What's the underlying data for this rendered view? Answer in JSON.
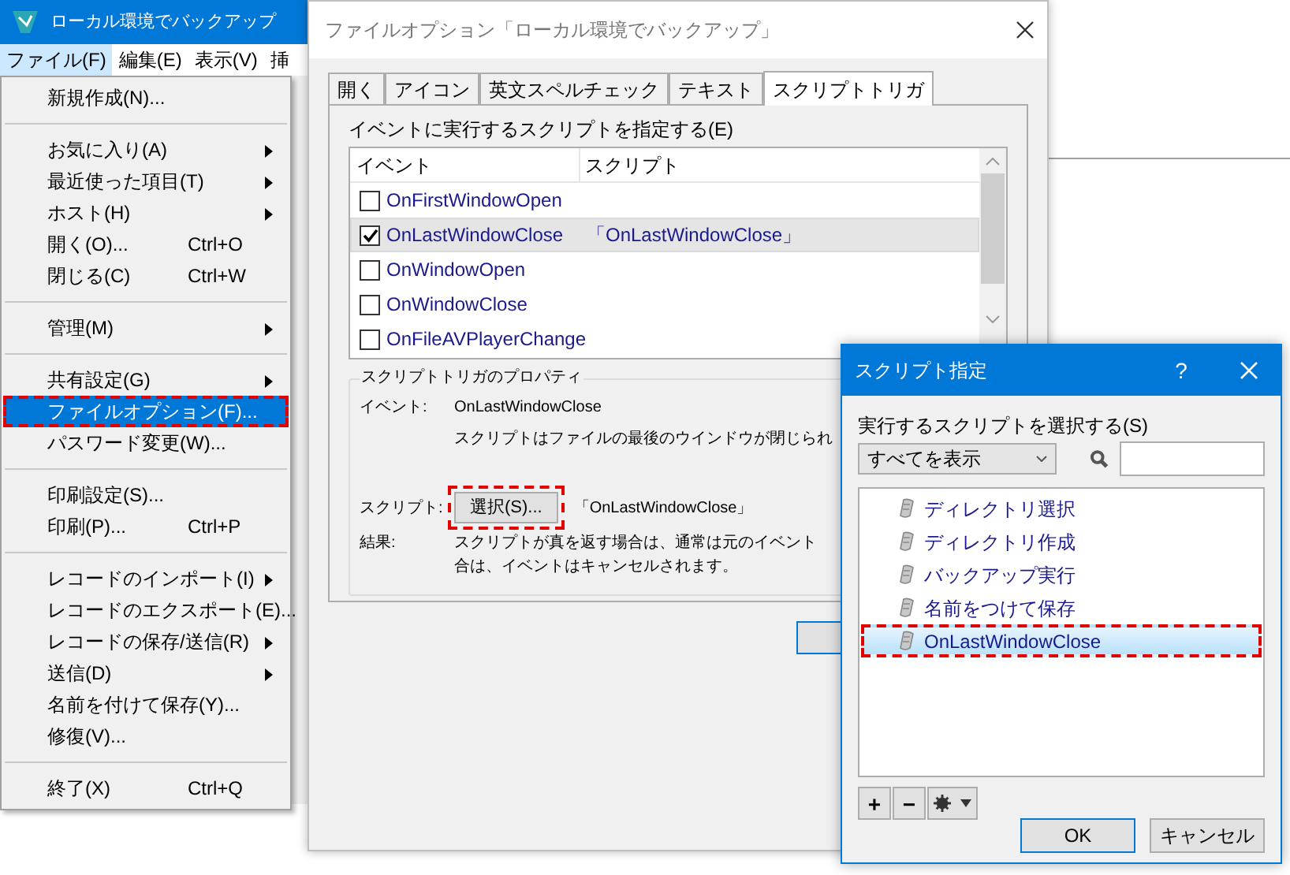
{
  "app_window": {
    "title": "ローカル環境でバックアップ",
    "menu_bar": [
      {
        "label": "ファイル(F)",
        "selected": true
      },
      {
        "label": "編集(E)",
        "selected": false
      },
      {
        "label": "表示(V)",
        "selected": false
      },
      {
        "label": "挿",
        "selected": false
      }
    ]
  },
  "file_menu": [
    {
      "kind": "item",
      "label": "新規作成(N)...",
      "submenu": false,
      "selected": false,
      "highlighted": false
    },
    {
      "kind": "separator"
    },
    {
      "kind": "item",
      "label": "お気に入り(A)",
      "submenu": true,
      "selected": false,
      "highlighted": false
    },
    {
      "kind": "item",
      "label": "最近使った項目(T)",
      "submenu": true,
      "selected": false,
      "highlighted": false
    },
    {
      "kind": "item",
      "label": "ホスト(H)",
      "submenu": true,
      "selected": false,
      "highlighted": false
    },
    {
      "kind": "item",
      "label": "開く(O)...",
      "shortcut": "Ctrl+O",
      "submenu": false,
      "selected": false,
      "highlighted": false
    },
    {
      "kind": "item",
      "label": "閉じる(C)",
      "shortcut": "Ctrl+W",
      "submenu": false,
      "selected": false,
      "highlighted": false
    },
    {
      "kind": "separator"
    },
    {
      "kind": "item",
      "label": "管理(M)",
      "submenu": true,
      "selected": false,
      "highlighted": false
    },
    {
      "kind": "separator"
    },
    {
      "kind": "item",
      "label": "共有設定(G)",
      "submenu": true,
      "selected": false,
      "highlighted": false
    },
    {
      "kind": "item",
      "label": "ファイルオプション(F)...",
      "submenu": false,
      "selected": true,
      "highlighted": true
    },
    {
      "kind": "item",
      "label": "パスワード変更(W)...",
      "submenu": false,
      "selected": false,
      "highlighted": false
    },
    {
      "kind": "separator"
    },
    {
      "kind": "item",
      "label": "印刷設定(S)...",
      "submenu": false,
      "selected": false,
      "highlighted": false
    },
    {
      "kind": "item",
      "label": "印刷(P)...",
      "shortcut": "Ctrl+P",
      "submenu": false,
      "selected": false,
      "highlighted": false
    },
    {
      "kind": "separator"
    },
    {
      "kind": "item",
      "label": "レコードのインポート(I)",
      "submenu": true,
      "selected": false,
      "highlighted": false
    },
    {
      "kind": "item",
      "label": "レコードのエクスポート(E)...",
      "submenu": false,
      "selected": false,
      "highlighted": false
    },
    {
      "kind": "item",
      "label": "レコードの保存/送信(R)",
      "submenu": true,
      "selected": false,
      "highlighted": false
    },
    {
      "kind": "item",
      "label": "送信(D)",
      "submenu": true,
      "selected": false,
      "highlighted": false
    },
    {
      "kind": "item",
      "label": "名前を付けて保存(Y)...",
      "submenu": false,
      "selected": false,
      "highlighted": false
    },
    {
      "kind": "item",
      "label": "修復(V)...",
      "submenu": false,
      "selected": false,
      "highlighted": false
    },
    {
      "kind": "separator"
    },
    {
      "kind": "item",
      "label": "終了(X)",
      "shortcut": "Ctrl+Q",
      "submenu": false,
      "selected": false,
      "highlighted": false
    }
  ],
  "options_dialog": {
    "title": "ファイルオプション「ローカル環境でバックアップ」",
    "tabs": [
      {
        "label": "開く",
        "selected": false
      },
      {
        "label": "アイコン",
        "selected": false
      },
      {
        "label": "英文スペルチェック",
        "selected": false
      },
      {
        "label": "テキスト",
        "selected": false
      },
      {
        "label": "スクリプトトリガ",
        "selected": true
      }
    ],
    "event_list_label": "イベントに実行するスクリプトを指定する(E)",
    "columns": [
      "イベント",
      "スクリプト"
    ],
    "rows": [
      {
        "event": "OnFirstWindowOpen",
        "checked": false,
        "selected": false
      },
      {
        "event": "OnLastWindowClose",
        "script": "「OnLastWindowClose」",
        "checked": true,
        "selected": true
      },
      {
        "event": "OnWindowOpen",
        "checked": false,
        "selected": false
      },
      {
        "event": "OnWindowClose",
        "checked": false,
        "selected": false
      },
      {
        "event": "OnFileAVPlayerChange",
        "checked": false,
        "selected": false
      }
    ],
    "properties": {
      "title": "スクリプトトリガのプロパティ",
      "event_label": "イベント:",
      "event_value": "OnLastWindowClose",
      "description": "スクリプトはファイルの最後のウインドウが閉じられ",
      "script_label": "スクリプト:",
      "select_button": {
        "label": "選択(S)...",
        "highlighted": true
      },
      "script_value": "「OnLastWindowClose」",
      "result_label": "結果:",
      "result_lines": [
        "スクリプトが真を返す場合は、通常は元のイベント",
        "合は、イベントはキャンセルされます。"
      ]
    }
  },
  "script_dialog": {
    "title": "スクリプト指定",
    "help": "?",
    "list_label": "実行するスクリプトを選択する(S)",
    "filter": "すべてを表示",
    "scripts": [
      {
        "label": "ディレクトリ選択",
        "selected": false,
        "highlighted": false
      },
      {
        "label": "ディレクトリ作成",
        "selected": false,
        "highlighted": false
      },
      {
        "label": "バックアップ実行",
        "selected": false,
        "highlighted": false
      },
      {
        "label": "名前をつけて保存",
        "selected": false,
        "highlighted": false
      },
      {
        "label": "OnLastWindowClose",
        "selected": true,
        "highlighted": true
      }
    ],
    "add": "+",
    "remove": "−",
    "buttons": [
      {
        "label": "OK",
        "default": true
      },
      {
        "label": "キャンセル",
        "default": false
      }
    ]
  }
}
